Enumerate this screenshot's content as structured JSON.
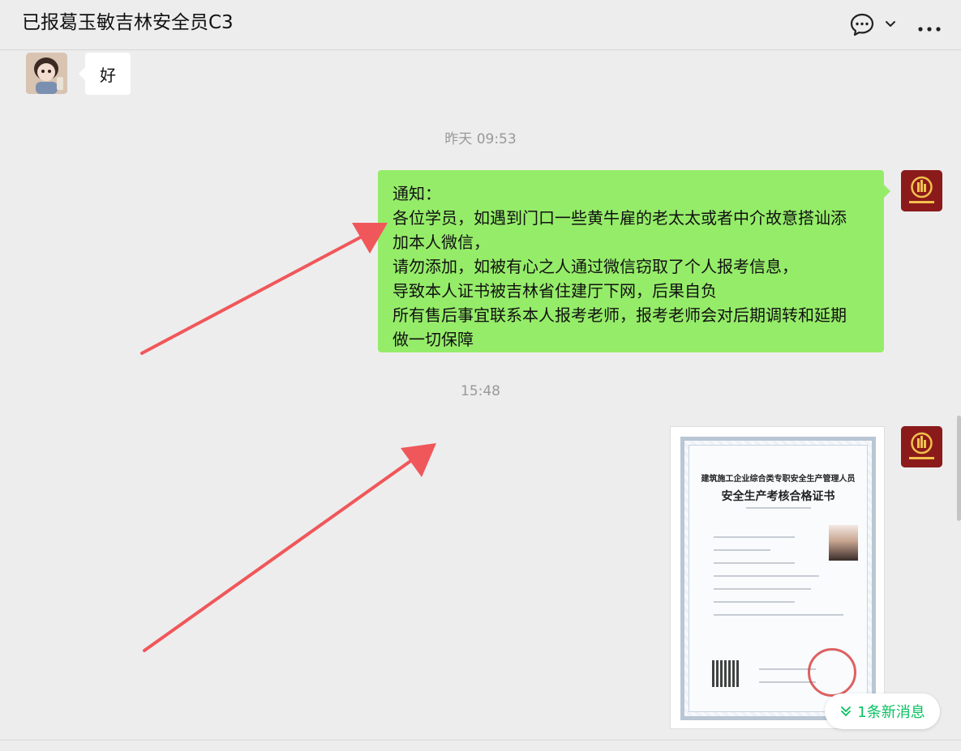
{
  "header": {
    "title": "已报葛玉敏吉林安全员C3",
    "chat_icon": "chat-bubble-icon",
    "more_icon": "more-dots-icon"
  },
  "messages": {
    "reply_text": "好",
    "timestamp_1": "昨天 09:53",
    "notice_lines": [
      "通知：",
      "各位学员，如遇到门口一些黄牛雇的老太太或者中介故意搭讪添",
      "加本人微信，",
      "请勿添加，如被有心之人通过微信窃取了个人报考信息，",
      "导致本人证书被吉林省住建厅下网，后果自负",
      "所有售后事宜联系本人报考老师，报考老师会对后期调转和延期",
      "做一切保障"
    ],
    "timestamp_2": "15:48"
  },
  "certificate": {
    "line1": "建筑施工企业综合类专职安全生产管理人员",
    "line2": "安全生产考核合格证书"
  },
  "new_messages": {
    "label": "1条新消息"
  },
  "colors": {
    "background": "#ededed",
    "outgoing_bubble": "#95ec69",
    "accent_green": "#07c160",
    "annotation_arrow": "#f0575a"
  }
}
